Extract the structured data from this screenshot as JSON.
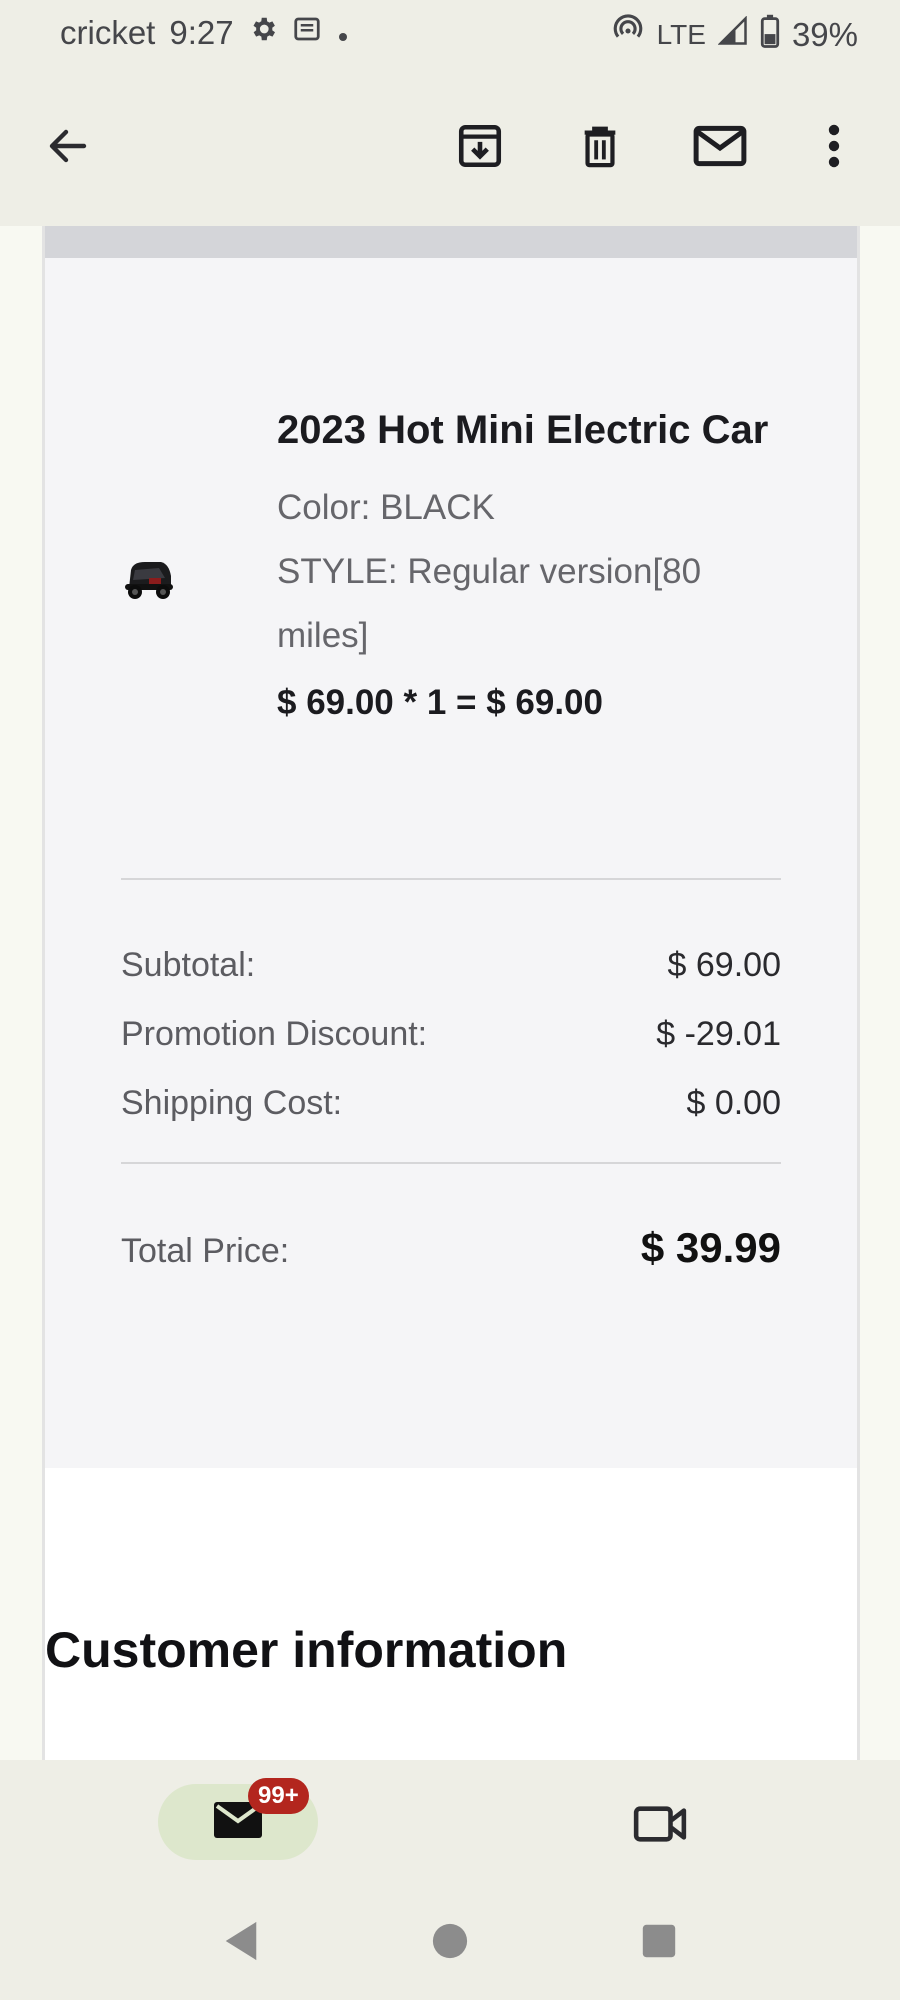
{
  "status_bar": {
    "carrier": "cricket",
    "time": "9:27",
    "network": "LTE",
    "battery": "39%"
  },
  "toolbar": {
    "back_icon": "arrow-left-icon",
    "archive_icon": "archive-icon",
    "delete_icon": "trash-icon",
    "mark_unread_icon": "mail-icon",
    "more_icon": "more-vert-icon"
  },
  "order": {
    "product_title": "2023 Hot Mini Electric Car",
    "color_line": "Color: BLACK",
    "style_line": "STYLE: Regular version[80 miles]",
    "price_line": "$ 69.00 * 1 = $ 69.00",
    "summary": [
      {
        "label": "Subtotal:",
        "value": "$ 69.00"
      },
      {
        "label": "Promotion Discount:",
        "value": "$ -29.01"
      },
      {
        "label": "Shipping Cost:",
        "value": "$ 0.00"
      }
    ],
    "total_label": "Total Price:",
    "total_value": "$ 39.99"
  },
  "section": {
    "customer_title": "Customer information"
  },
  "bottom_nav": {
    "mail_badge": "99+",
    "mail_icon": "mail-icon",
    "video_icon": "video-icon"
  },
  "colors": {
    "badge": "#b3261e",
    "pill": "#dde7cc",
    "order_box": "#f5f5f7"
  }
}
